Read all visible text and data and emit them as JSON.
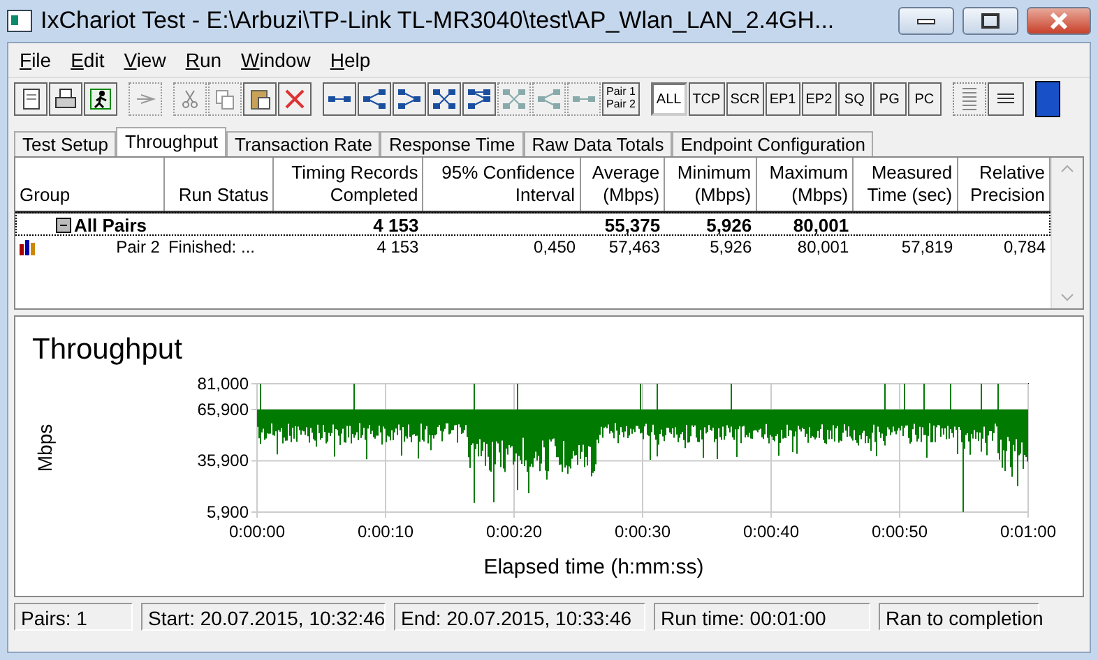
{
  "window": {
    "title": "IxChariot Test - E:\\Arbuzi\\TP-Link TL-MR3040\\test\\AP_Wlan_LAN_2.4GH..."
  },
  "menu": [
    "File",
    "Edit",
    "View",
    "Run",
    "Window",
    "Help"
  ],
  "toolbar": {
    "pair_button": [
      "Pair 1",
      "Pair 2"
    ],
    "filters": [
      {
        "label": "ALL",
        "selected": true
      },
      {
        "label": "TCP",
        "selected": false
      },
      {
        "label": "SCR",
        "selected": false
      },
      {
        "label": "EP1",
        "selected": false
      },
      {
        "label": "EP2",
        "selected": false
      },
      {
        "label": "SQ",
        "selected": false
      },
      {
        "label": "PG",
        "selected": false
      },
      {
        "label": "PC",
        "selected": false
      }
    ]
  },
  "tabs": [
    {
      "label": "Test Setup",
      "selected": false
    },
    {
      "label": "Throughput",
      "selected": true
    },
    {
      "label": "Transaction Rate",
      "selected": false
    },
    {
      "label": "Response Time",
      "selected": false
    },
    {
      "label": "Raw Data Totals",
      "selected": false
    },
    {
      "label": "Endpoint Configuration",
      "selected": false
    }
  ],
  "table": {
    "columns": [
      "Group",
      "Run Status",
      "Timing Records\nCompleted",
      "95% Confidence\nInterval",
      "Average\n(Mbps)",
      "Minimum\n(Mbps)",
      "Maximum\n(Mbps)",
      "Measured\nTime (sec)",
      "Relative\nPrecision"
    ],
    "rows": [
      {
        "kind": "group",
        "expanded": true,
        "cells": [
          "All Pairs",
          null,
          "4 153",
          null,
          "55,375",
          "5,926",
          "80,001",
          null,
          null
        ]
      },
      {
        "kind": "pair",
        "cells": [
          "Pair 2",
          "Finished: ...",
          "4 153",
          "0,450",
          "57,463",
          "5,926",
          "80,001",
          "57,819",
          "0,784"
        ]
      }
    ]
  },
  "chart": {
    "title": "Throughput",
    "ylabel": "Mbps",
    "xlabel": "Elapsed time (h:mm:ss)",
    "yticks": [
      "81,000",
      "65,900",
      "35,900",
      "5,900"
    ],
    "xticks": [
      "0:00:00",
      "0:00:10",
      "0:00:20",
      "0:00:30",
      "0:00:40",
      "0:00:50",
      "0:01:00"
    ]
  },
  "status_bar": [
    "Pairs: 1",
    "Start: 20.07.2015, 10:32:46",
    "End: 20.07.2015, 10:33:46",
    "Run time: 00:01:00",
    "Ran to completion"
  ]
}
